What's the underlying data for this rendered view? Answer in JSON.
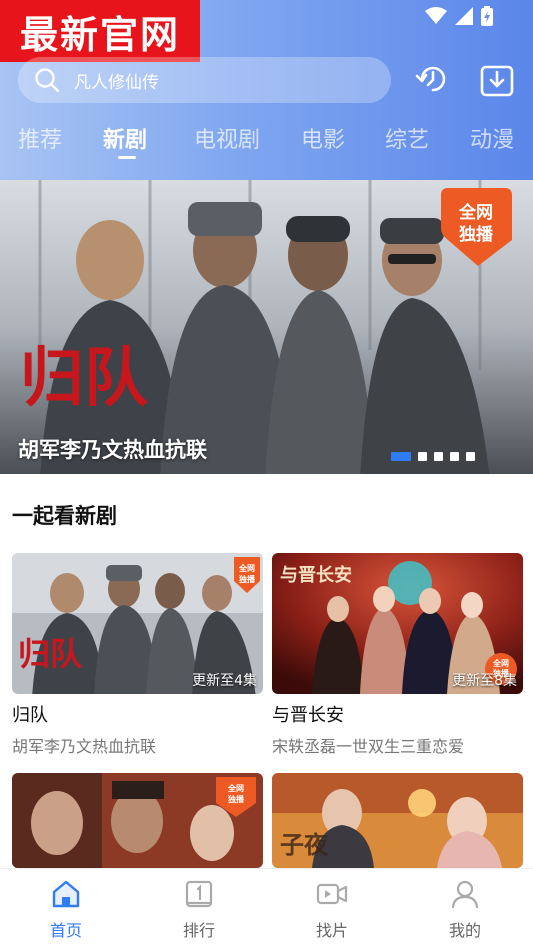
{
  "promo": {
    "text": "最新官网"
  },
  "search": {
    "placeholder": "凡人修仙传"
  },
  "tabs": [
    {
      "label": "推荐",
      "active": false
    },
    {
      "label": "新剧",
      "active": true
    },
    {
      "label": "电视剧",
      "active": false
    },
    {
      "label": "电影",
      "active": false
    },
    {
      "label": "综艺",
      "active": false
    },
    {
      "label": "动漫",
      "active": false
    }
  ],
  "banner": {
    "title": "胡军李乃文热血抗联",
    "logo_text": "归队",
    "badge_line1": "全网",
    "badge_line2": "独播",
    "dots_count": 5,
    "active_dot": 0
  },
  "section": {
    "title": "一起看新剧"
  },
  "cards": [
    {
      "name": "归队",
      "desc": "胡军李乃文热血抗联",
      "episode": "更新至4集",
      "logo": "归队"
    },
    {
      "name": "与晋长安",
      "desc": "宋轶丞磊一世双生三重恋爱",
      "episode": "更新至8集",
      "logo": "与晋长安"
    },
    {
      "name": "",
      "desc": "",
      "episode": "",
      "logo": ""
    },
    {
      "name": "",
      "desc": "",
      "episode": "",
      "logo": ""
    }
  ],
  "bottom_nav": [
    {
      "label": "首页",
      "icon": "home-icon",
      "active": true
    },
    {
      "label": "排行",
      "icon": "ranking-icon",
      "active": false
    },
    {
      "label": "找片",
      "icon": "video-camera-icon",
      "active": false
    },
    {
      "label": "我的",
      "icon": "user-icon",
      "active": false
    }
  ],
  "colors": {
    "accent": "#2f7cf6",
    "promo_red": "#e8141c",
    "header_start": "#a8c4f3",
    "header_end": "#5b86ea"
  }
}
